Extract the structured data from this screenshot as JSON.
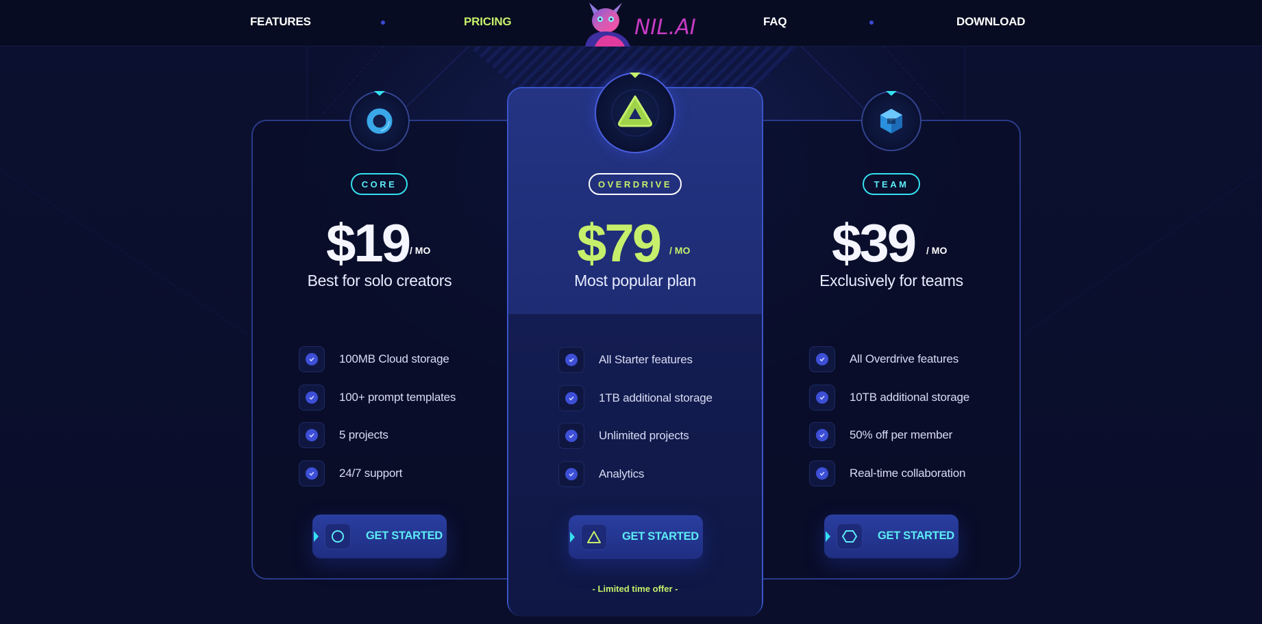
{
  "nav": {
    "items": [
      {
        "label": "FEATURES",
        "active": false
      },
      {
        "label": "PRICING",
        "active": true
      },
      {
        "label": "FAQ",
        "active": false
      },
      {
        "label": "DOWNLOAD",
        "active": false
      }
    ],
    "logo_text": "NIL.AI"
  },
  "colors": {
    "accent_lime": "#c6f06b",
    "accent_cyan": "#35e0ef",
    "brand_magenta": "#c73bc4",
    "check_blue": "#3d4fd6",
    "background": "#0a0e2a"
  },
  "plans": [
    {
      "id": "core",
      "badge": "CORE",
      "price": "$19",
      "period": "/ MO",
      "tagline": "Best for solo creators",
      "icon": "ring-icon",
      "features": [
        "100MB Cloud storage",
        "100+ prompt templates",
        "5 projects",
        "24/7 support"
      ],
      "cta": "GET STARTED"
    },
    {
      "id": "overdrive",
      "badge": "OVERDRIVE",
      "price": "$79",
      "period": "/ MO",
      "tagline": "Most popular plan",
      "icon": "triangle-icon",
      "features": [
        "All Starter features",
        "1TB additional storage",
        "Unlimited projects",
        "Analytics"
      ],
      "cta": "GET STARTED",
      "offer": "-   Limited time offer   -"
    },
    {
      "id": "team",
      "badge": "TEAM",
      "price": "$39",
      "period": "/ MO",
      "tagline": "Exclusively for teams",
      "icon": "hexagon-icon",
      "features": [
        "All Overdrive features",
        "10TB additional storage",
        "50% off per member",
        "Real-time collaboration"
      ],
      "cta": "GET STARTED"
    }
  ]
}
